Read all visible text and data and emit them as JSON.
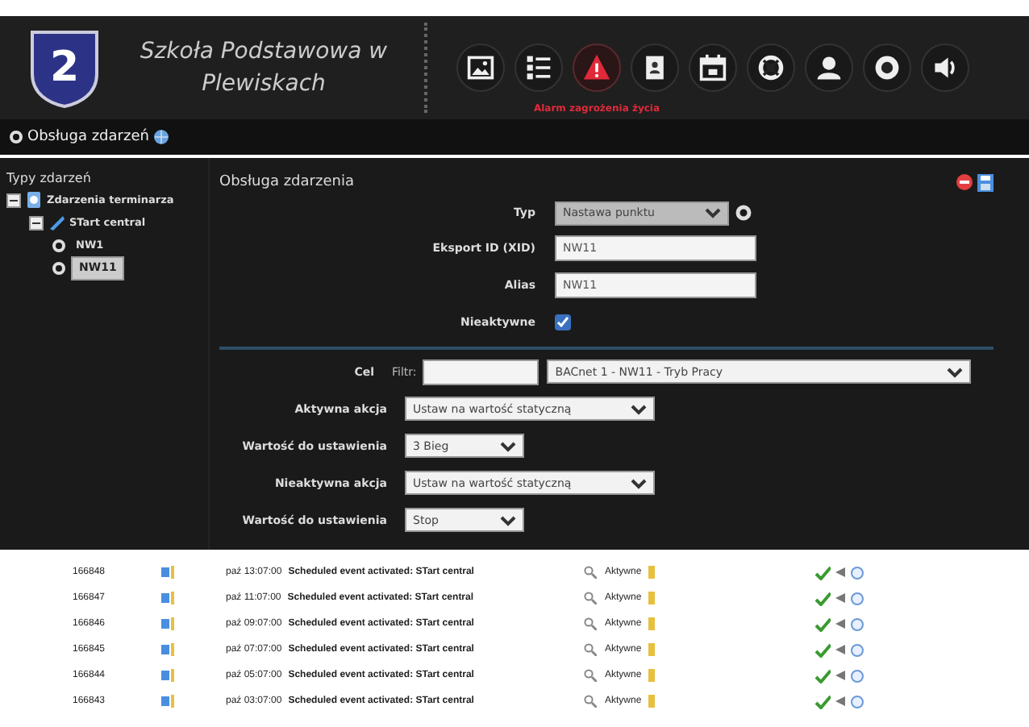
{
  "header": {
    "logo_number": "2",
    "title": "Szkoła Podstawowa w Plewiskach",
    "toolbar": [
      {
        "kind": "image",
        "selected": false
      },
      {
        "kind": "list",
        "selected": false
      },
      {
        "kind": "alert",
        "selected": true,
        "label": "Alarm zagrożenia życia"
      },
      {
        "kind": "contact",
        "selected": false
      },
      {
        "kind": "calendar",
        "selected": false
      },
      {
        "kind": "lifebuoy",
        "selected": false
      },
      {
        "kind": "person",
        "selected": false
      },
      {
        "kind": "stop",
        "selected": false
      },
      {
        "kind": "speaker",
        "selected": false
      }
    ]
  },
  "section": {
    "title": "Obsługa zdarzeń"
  },
  "tree": {
    "heading": "Typy zdarzeń",
    "items": [
      {
        "label": "Zdarzenia terminarza",
        "expanded": true,
        "children": [
          {
            "label": "STart central",
            "expanded": true,
            "children": [
              {
                "label": "NW1",
                "selected": false
              },
              {
                "label": "NW11",
                "selected": true
              }
            ]
          }
        ]
      }
    ]
  },
  "form": {
    "title": "Obsługa zdarzenia",
    "fields": [
      {
        "kind": "select",
        "label": "Typ",
        "value": "Nastawa punktu"
      },
      {
        "kind": "input",
        "label": "Eksport ID (XID)",
        "value": "NW11"
      },
      {
        "kind": "input",
        "label": "Alias",
        "value": "NW11"
      },
      {
        "kind": "checkbox",
        "label": "Nieaktywne",
        "checked": true
      }
    ],
    "target": {
      "label": "Cel",
      "filter_label": "Filtr:",
      "value": "BACnet 1 - NW11 - Tryb Pracy"
    },
    "actions": [
      {
        "label": "Aktywna akcja",
        "value": "Ustaw na wartość statyczną",
        "kind": "wide"
      },
      {
        "label": "Wartość do ustawienia",
        "value": "3 Bieg",
        "kind": "narrow"
      },
      {
        "label": "Nieaktywna akcja",
        "value": "Ustaw na wartość statyczną",
        "kind": "wide"
      },
      {
        "label": "Wartość do ustawienia",
        "value": "Stop",
        "kind": "narrow"
      }
    ]
  },
  "events": [
    {
      "id": "166848",
      "time": "paź 13:07:00",
      "message": "Scheduled event activated: STart central",
      "status": "Aktywne"
    },
    {
      "id": "166847",
      "time": "paź 11:07:00",
      "message": "Scheduled event activated: STart central",
      "status": "Aktywne"
    },
    {
      "id": "166846",
      "time": "paź 09:07:00",
      "message": "Scheduled event activated: STart central",
      "status": "Aktywne"
    },
    {
      "id": "166845",
      "time": "paź 07:07:00",
      "message": "Scheduled event activated: STart central",
      "status": "Aktywne"
    },
    {
      "id": "166844",
      "time": "paź 05:07:00",
      "message": "Scheduled event activated: STart central",
      "status": "Aktywne"
    },
    {
      "id": "166843",
      "time": "paź 03:07:00",
      "message": "Scheduled event activated: STart central",
      "status": "Aktywne"
    }
  ]
}
